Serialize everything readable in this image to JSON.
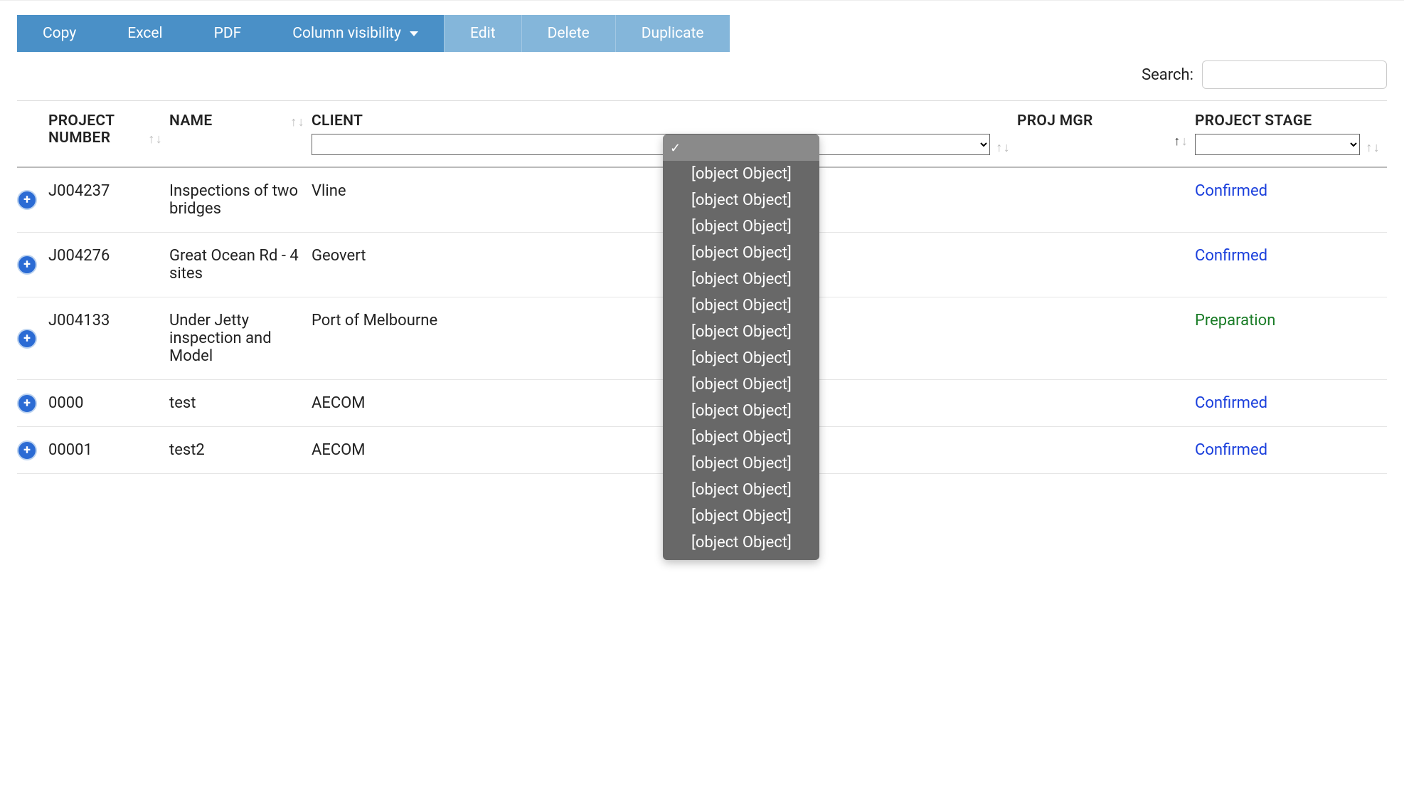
{
  "toolbar": {
    "copy": "Copy",
    "excel": "Excel",
    "pdf": "PDF",
    "colvis": "Column visibility",
    "edit": "Edit",
    "delete": "Delete",
    "duplicate": "Duplicate"
  },
  "search": {
    "label": "Search:",
    "value": ""
  },
  "columns": {
    "project_number": "PROJECT NUMBER",
    "name": "NAME",
    "client": "CLIENT",
    "proj_mgr": "PROJ MGR",
    "project_stage": "PROJECT STAGE"
  },
  "rows": [
    {
      "project_number": "J004237",
      "name": "Inspections of two bridges",
      "client": "Vline",
      "stage": "Confirmed",
      "stage_class": "confirmed"
    },
    {
      "project_number": "J004276",
      "name": "Great Ocean Rd - 4 sites",
      "client": "Geovert",
      "stage": "Confirmed",
      "stage_class": "confirmed"
    },
    {
      "project_number": "J004133",
      "name": "Under Jetty inspection and Model",
      "client": "Port of Melbourne",
      "stage": "Preparation",
      "stage_class": "preparation"
    },
    {
      "project_number": "0000",
      "name": "test",
      "client": "AECOM",
      "stage": "Confirmed",
      "stage_class": "confirmed"
    },
    {
      "project_number": "00001",
      "name": "test2",
      "client": "AECOM",
      "stage": "Confirmed",
      "stage_class": "confirmed"
    }
  ],
  "dropdown": {
    "selected": "",
    "options": [
      "[object Object]",
      "[object Object]",
      "[object Object]",
      "[object Object]",
      "[object Object]",
      "[object Object]",
      "[object Object]",
      "[object Object]",
      "[object Object]",
      "[object Object]",
      "[object Object]",
      "[object Object]",
      "[object Object]",
      "[object Object]",
      "[object Object]"
    ]
  }
}
